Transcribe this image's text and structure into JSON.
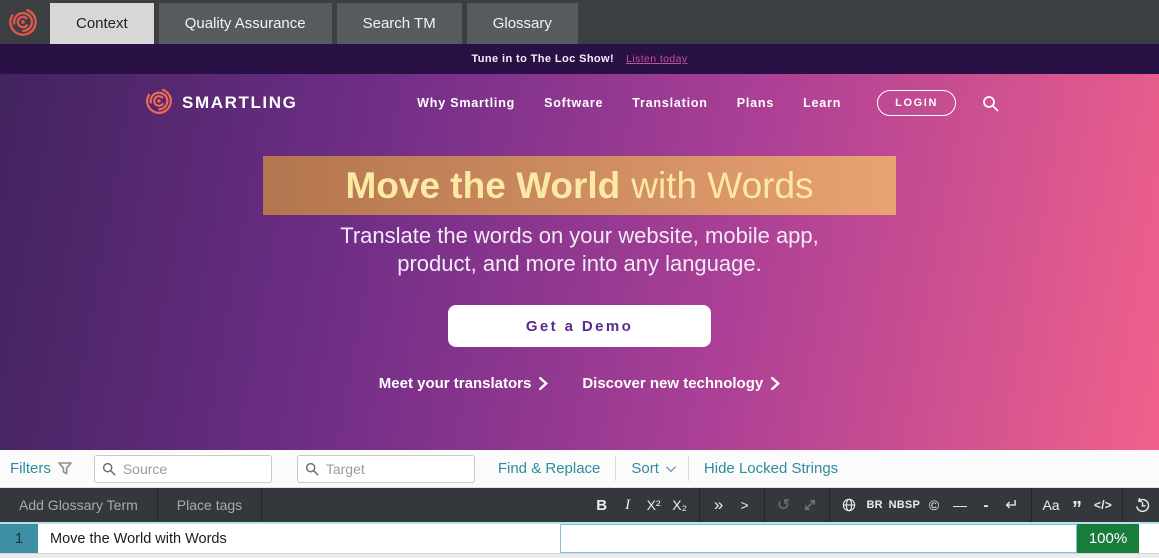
{
  "workbench": {
    "tabs": [
      {
        "label": "Context",
        "active": true
      },
      {
        "label": "Quality Assurance",
        "active": false
      },
      {
        "label": "Search TM",
        "active": false
      },
      {
        "label": "Glossary",
        "active": false
      }
    ]
  },
  "banner": {
    "text": "Tune in to The Loc Show!",
    "link_label": "Listen today"
  },
  "site": {
    "brand": "SMARTLING",
    "nav": [
      "Why Smartling",
      "Software",
      "Translation",
      "Plans",
      "Learn"
    ],
    "login_label": "LOGIN",
    "hero": {
      "title_bold": "Move the World",
      "title_light": "with Words",
      "subtitle_line1": "Translate the words on your website, mobile app,",
      "subtitle_line2": "product, and more into any language.",
      "cta_label": "Get a Demo",
      "link1": "Meet your translators",
      "link2": "Discover new technology"
    }
  },
  "filter_bar": {
    "filters_label": "Filters",
    "source_placeholder": "Source",
    "target_placeholder": "Target",
    "find_replace_label": "Find & Replace",
    "sort_label": "Sort",
    "hide_locked_label": "Hide Locked Strings"
  },
  "editor_toolbar": {
    "add_glossary_label": "Add Glossary Term",
    "place_tags_label": "Place tags",
    "icons": {
      "bold": "B",
      "italic": "I",
      "superscript": "X²",
      "subscript": "X₂",
      "insert_all_tags": "»",
      "insert_next_tag": ">",
      "undo": "↺",
      "br": "BR",
      "nbsp": "NBSP",
      "copyright": "©",
      "em_dash": "—",
      "hyphen": "-",
      "carriage_return": "↵",
      "change_case": "Aa",
      "smart_quotes": "”",
      "code": "</>"
    }
  },
  "string_editor": {
    "row_number": "1",
    "source_text": "Move the World with Words",
    "target_text": "",
    "match_badge": "100%"
  },
  "colors": {
    "accent_teal": "#2e8ca0",
    "badge_green": "#187c3b",
    "brand_red": "#e2574c",
    "site_purple": "#5b2b8c",
    "banner_link_pink": "#c0549c",
    "highlight_orange": "#d98f63",
    "row_number_teal": "#3e8fa4"
  }
}
